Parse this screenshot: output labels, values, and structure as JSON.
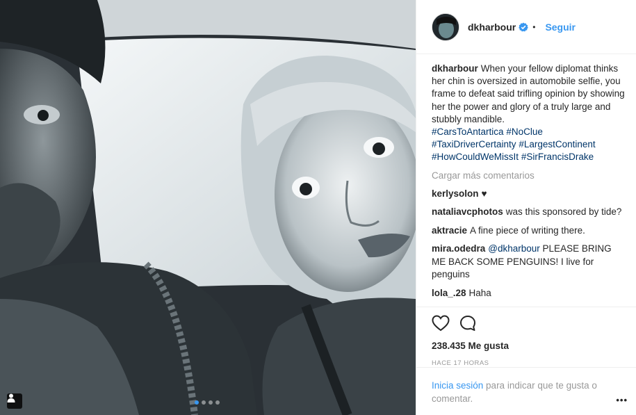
{
  "post": {
    "username": "dkharbour",
    "bullet": "•",
    "follow_label": "Seguir",
    "carousel_count": 4,
    "carousel_active": 0
  },
  "caption": {
    "username": "dkharbour",
    "text": "When your fellow diplomat thinks her chin is oversized in automobile selfie, you frame to defeat said trifling opinion by showing her the power and glory of a truly large and stubbly mandible.",
    "hashtags": [
      "#CarsToAntartica",
      "#NoClue",
      "#TaxiDriverCertainty",
      "#LargestContinent",
      "#HowCouldWeMissIt",
      "#SirFrancisDrake"
    ]
  },
  "load_more_label": "Cargar más comentarios",
  "comments": [
    {
      "user": "kerlysolon",
      "mention": "",
      "text": "♥"
    },
    {
      "user": "nataliavcphotos",
      "mention": "",
      "text": "was this sponsored by tide?"
    },
    {
      "user": "aktracie",
      "mention": "",
      "text": "A fine piece of writing there."
    },
    {
      "user": "mira.odedra",
      "mention": "@dkharbour",
      "text": "PLEASE BRING ME BACK SOME PENGUINS! I live for penguins"
    },
    {
      "user": "lola_.28",
      "mention": "",
      "text": "Haha"
    }
  ],
  "actions": {
    "like_icon": "heart-icon",
    "comment_icon": "comment-icon",
    "likes_text": "238.435 Me gusta",
    "time_text": "HACE 17 HORAS"
  },
  "login": {
    "link_text": "Inicia sesión",
    "rest_text": " para indicar que te gusta o comentar.",
    "more_label": "•••"
  },
  "colors": {
    "link_blue": "#3897f0",
    "hashtag_blue": "#003569",
    "muted_grey": "#999999",
    "border": "#efefef"
  },
  "icons": {
    "tag_badge": "user-tag-icon",
    "verified": "verified-badge-icon"
  }
}
